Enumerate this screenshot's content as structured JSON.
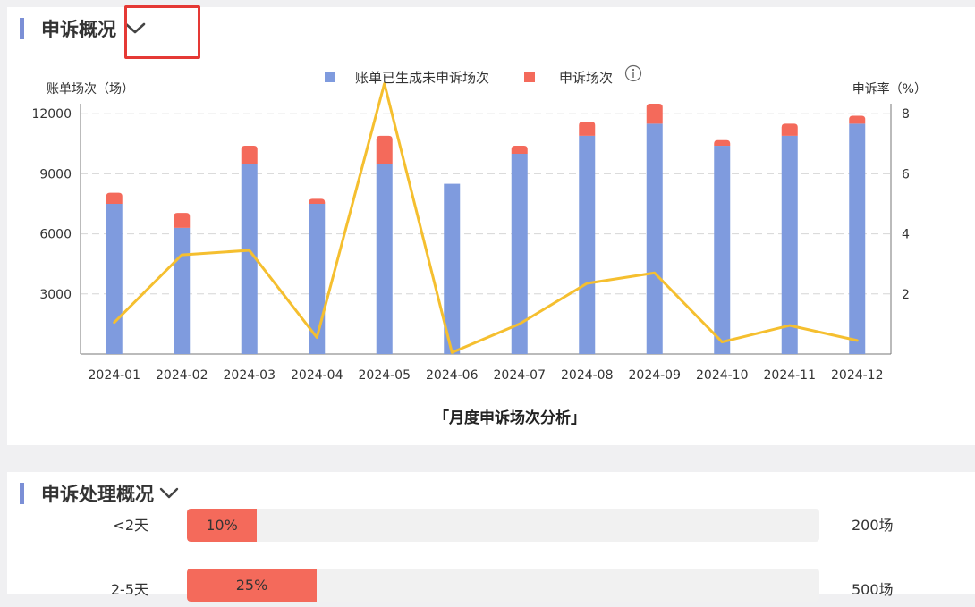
{
  "overview": {
    "title": "申诉概况",
    "chevron_icon": "chevron-down-icon",
    "info_icon": "info-icon"
  },
  "chart_data": {
    "type": "bar",
    "title": "「月度申诉场次分析」",
    "ylabel_left": "账单场次（场）",
    "ylabel_right": "申诉率（%）",
    "categories": [
      "2024-01",
      "2024-02",
      "2024-03",
      "2024-04",
      "2024-05",
      "2024-06",
      "2024-07",
      "2024-08",
      "2024-09",
      "2024-10",
      "2024-11",
      "2024-12"
    ],
    "left_ticks": [
      3000,
      6000,
      9000,
      12000
    ],
    "right_ticks": [
      2,
      4,
      6,
      8
    ],
    "ylim_left": [
      0,
      12500
    ],
    "ylim_right": [
      0,
      8.33
    ],
    "grid": true,
    "legend_position": "top-center",
    "series": [
      {
        "name": "账单已生成未申诉场次",
        "type": "bar-stacked",
        "color": "#7f9bde",
        "values": [
          7500,
          6300,
          9500,
          7500,
          9500,
          8500,
          10000,
          10900,
          11500,
          10400,
          10900,
          11500
        ]
      },
      {
        "name": "申诉场次",
        "type": "bar-stacked",
        "color": "#f46a5b",
        "values": [
          550,
          750,
          900,
          250,
          1400,
          0,
          400,
          700,
          1000,
          280,
          600,
          400
        ]
      },
      {
        "name": "申诉率",
        "type": "line",
        "axis": "right",
        "color": "#f5bf2f",
        "values": [
          1.05,
          3.3,
          3.45,
          0.55,
          9.0,
          0.05,
          1.0,
          2.35,
          2.7,
          0.4,
          0.95,
          0.45
        ]
      }
    ]
  },
  "processing": {
    "title": "申诉处理概况",
    "chevron_icon": "chevron-down-icon",
    "rows": [
      {
        "label": "<2天",
        "percent_text": "10%",
        "fraction": 0.11,
        "count": "200场"
      },
      {
        "label": "2-5天",
        "percent_text": "25%",
        "fraction": 0.205,
        "count": "500场"
      }
    ]
  }
}
